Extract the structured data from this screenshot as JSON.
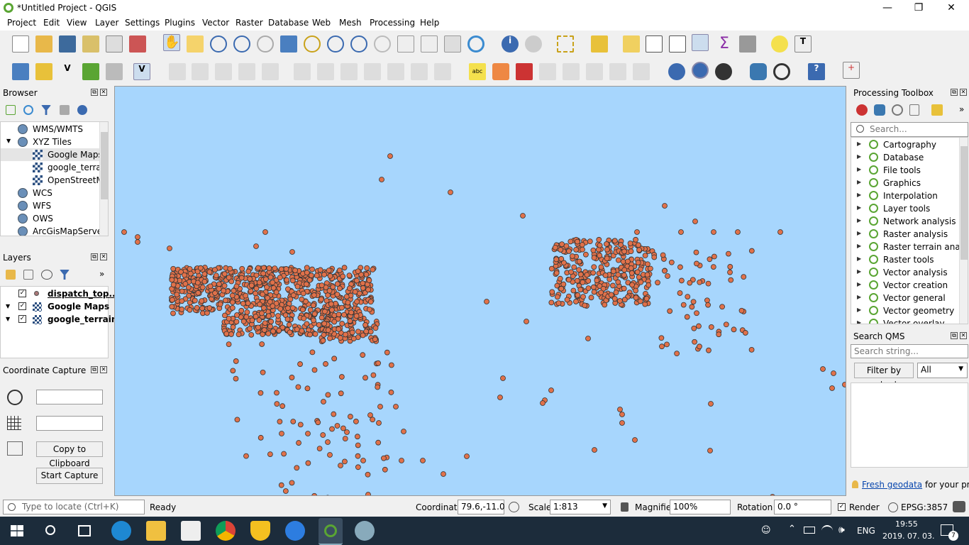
{
  "window": {
    "title": "*Untitled Project - QGIS",
    "minimize": "—",
    "maximize": "❐",
    "close": "✕"
  },
  "menu": [
    "Project",
    "Edit",
    "View",
    "Layer",
    "Settings",
    "Plugins",
    "Vector",
    "Raster",
    "Database",
    "Web",
    "Mesh",
    "Processing",
    "Help"
  ],
  "browser": {
    "title": "Browser",
    "items": [
      {
        "label": "WMS/WMTS",
        "indent": 0,
        "icon": "globe-icon"
      },
      {
        "label": "XYZ Tiles",
        "indent": 0,
        "icon": "globe-icon",
        "expanded": true
      },
      {
        "label": "Google Maps",
        "indent": 1,
        "icon": "tile-icon",
        "selected": true
      },
      {
        "label": "google_terrain",
        "indent": 1,
        "icon": "tile-icon"
      },
      {
        "label": "OpenStreetMap",
        "indent": 1,
        "icon": "tile-icon"
      },
      {
        "label": "WCS",
        "indent": 0,
        "icon": "globe-icon"
      },
      {
        "label": "WFS",
        "indent": 0,
        "icon": "globe-icon"
      },
      {
        "label": "OWS",
        "indent": 0,
        "icon": "globe-icon"
      },
      {
        "label": "ArcGisMapServer",
        "indent": 0,
        "icon": "globe-icon"
      }
    ]
  },
  "layers": {
    "title": "Layers",
    "items": [
      {
        "label": "dispatch_top...",
        "checked": true,
        "type": "point"
      },
      {
        "label": "Google Maps",
        "checked": true,
        "type": "raster"
      },
      {
        "label": "google_terrain",
        "checked": true,
        "type": "raster"
      }
    ]
  },
  "coordinate_capture": {
    "title": "Coordinate Capture",
    "copy_label": "Copy to Clipboard",
    "start_label": "Start Capture"
  },
  "toolbox": {
    "title": "Processing Toolbox",
    "search_placeholder": "Search...",
    "items": [
      "Cartography",
      "Database",
      "File tools",
      "Graphics",
      "Interpolation",
      "Layer tools",
      "Network analysis",
      "Raster analysis",
      "Raster terrain ana...",
      "Raster tools",
      "Vector analysis",
      "Vector creation",
      "Vector general",
      "Vector geometry",
      "Vector overlay"
    ]
  },
  "qms": {
    "title": "Search QMS",
    "placeholder": "Search string...",
    "filter_label": "Filter by extent",
    "filter_value": "All",
    "fresh_link": "Fresh geodata",
    "fresh_text": "for your project"
  },
  "status": {
    "locate_placeholder": "Type to locate (Ctrl+K)",
    "ready": "Ready",
    "coordinate_label": "Coordinate",
    "coordinate_value": "79.6,-11.0",
    "scale_label": "Scale",
    "scale_value": "1:813",
    "magnifier_label": "Magnifier",
    "magnifier_value": "100%",
    "rotation_label": "Rotation",
    "rotation_value": "0.0 °",
    "render_label": "Render",
    "crs": "EPSG:3857"
  },
  "taskbar": {
    "lang": "ENG",
    "time": "19:55",
    "date": "2019. 07. 03.",
    "notif": "7"
  },
  "colors": {
    "map_bg": "#a7d6fd",
    "point_fill": "#e0714a",
    "point_stroke": "#333333",
    "qgis_green": "#5aa533"
  }
}
